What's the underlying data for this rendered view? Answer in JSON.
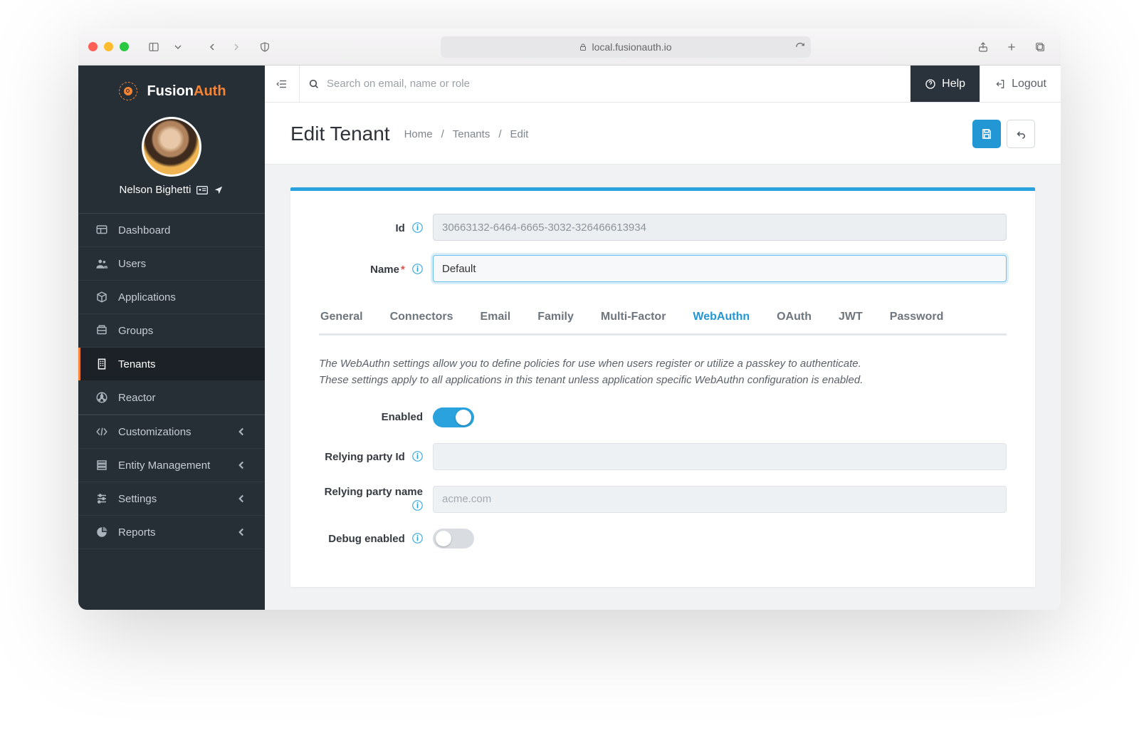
{
  "browser": {
    "url_host": "local.fusionauth.io"
  },
  "brand": {
    "name_a": "Fusion",
    "name_b": "Auth"
  },
  "user": {
    "display_name": "Nelson Bighetti"
  },
  "sidebar": {
    "items": [
      {
        "label": "Dashboard"
      },
      {
        "label": "Users"
      },
      {
        "label": "Applications"
      },
      {
        "label": "Groups"
      },
      {
        "label": "Tenants"
      },
      {
        "label": "Reactor"
      },
      {
        "label": "Customizations"
      },
      {
        "label": "Entity Management"
      },
      {
        "label": "Settings"
      },
      {
        "label": "Reports"
      }
    ],
    "active_index": 4
  },
  "topbar": {
    "search_placeholder": "Search on email, name or role",
    "help_label": "Help",
    "logout_label": "Logout"
  },
  "page": {
    "title": "Edit Tenant",
    "breadcrumbs": [
      "Home",
      "Tenants",
      "Edit"
    ]
  },
  "form": {
    "id_label": "Id",
    "id_value": "30663132-6464-6665-3032-326466613934",
    "name_label": "Name",
    "name_value": "Default"
  },
  "tabs": {
    "items": [
      "General",
      "Connectors",
      "Email",
      "Family",
      "Multi-Factor",
      "WebAuthn",
      "OAuth",
      "JWT",
      "Password"
    ],
    "active": "WebAuthn"
  },
  "webauthn": {
    "description": "The WebAuthn settings allow you to define policies for use when users register or utilize a passkey to authenticate. These settings apply to all applications in this tenant unless application specific WebAuthn configuration is enabled.",
    "enabled_label": "Enabled",
    "enabled": true,
    "rp_id_label": "Relying party Id",
    "rp_id_value": "",
    "rp_name_label": "Relying party name",
    "rp_name_value": "",
    "rp_name_placeholder": "acme.com",
    "debug_label": "Debug enabled",
    "debug": false
  }
}
